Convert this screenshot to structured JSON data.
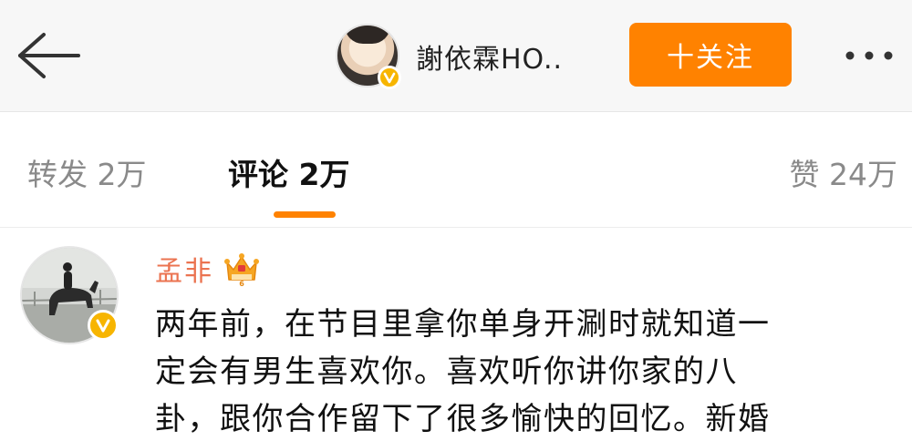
{
  "header": {
    "back_icon": "back-arrow-icon",
    "user_name": "謝依霖HO..",
    "verified_color": "#f7b500",
    "follow_label": "十关注",
    "follow_color": "#ff8200",
    "more_icon": "more-dots-icon"
  },
  "tabs": {
    "repost_label": "转发 2万",
    "comments_label": "评论 2万",
    "likes_label": "赞 24万",
    "active": "comments",
    "active_color": "#ff8200"
  },
  "comment": {
    "name": "孟非",
    "name_color": "#eb7350",
    "badge_icon": "crown-icon",
    "text_lines": [
      "两年前，在节目里拿你单身开涮时就知道一",
      "定会有男生喜欢你。喜欢听你讲你家的八",
      "卦，跟你合作留下了很多愉快的回忆。新婚"
    ]
  }
}
